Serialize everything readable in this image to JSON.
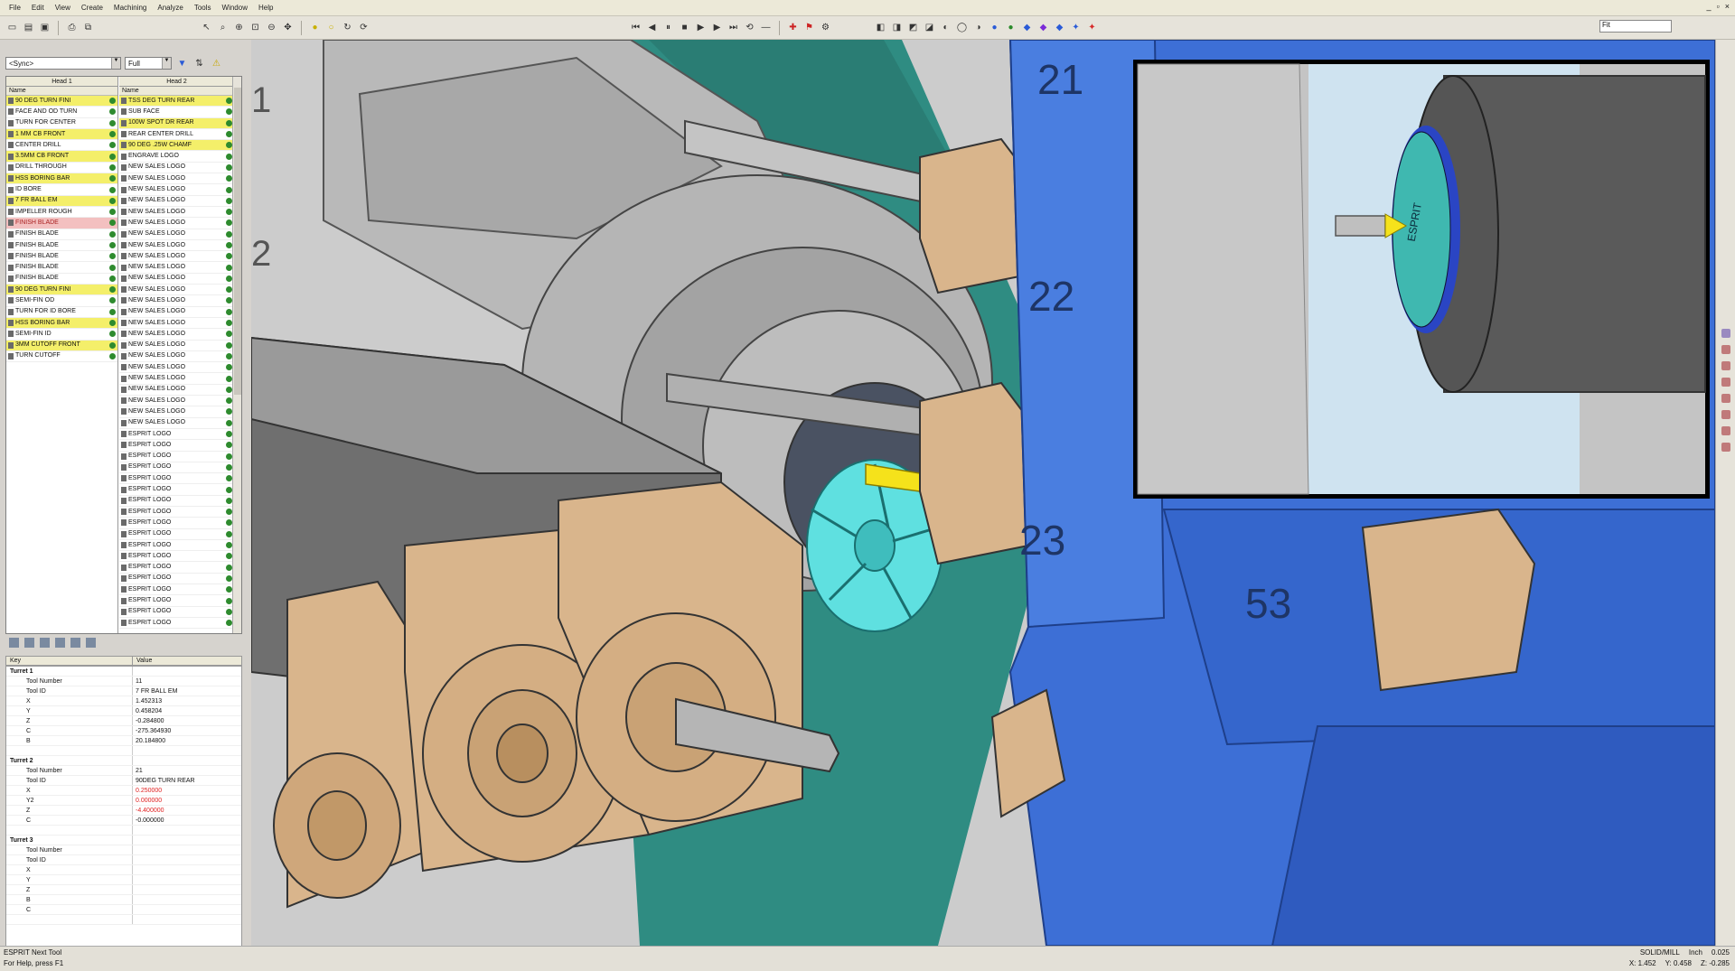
{
  "menu": [
    "File",
    "Edit",
    "View",
    "Create",
    "Machining",
    "Analyze",
    "Tools",
    "Window",
    "Help"
  ],
  "toolbar": {
    "zoom_value": "Fit"
  },
  "filter": {
    "group_value": "<Sync>",
    "size_value": "Full"
  },
  "ops": {
    "head1_label": "Head 1",
    "head2_label": "Head 2",
    "name_header": "Name",
    "head1_rows": [
      {
        "label": "90 DEG TURN FINI",
        "state": "hl"
      },
      {
        "label": "FACE AND OD TURN",
        "state": ""
      },
      {
        "label": "TURN FOR CENTER",
        "state": ""
      },
      {
        "label": "1 MM CB FRONT",
        "state": "hl"
      },
      {
        "label": "CENTER DRILL",
        "state": ""
      },
      {
        "label": "3.5MM CB FRONT",
        "state": "hl"
      },
      {
        "label": "DRILL THROUGH",
        "state": ""
      },
      {
        "label": "HSS BORING BAR",
        "state": "hl"
      },
      {
        "label": "ID BORE",
        "state": ""
      },
      {
        "label": "7 FR BALL EM",
        "state": "hl"
      },
      {
        "label": "IMPELLER ROUGH",
        "state": ""
      },
      {
        "label": "FINISH BLADE",
        "state": "sel"
      },
      {
        "label": "FINISH BLADE",
        "state": ""
      },
      {
        "label": "FINISH BLADE",
        "state": ""
      },
      {
        "label": "FINISH BLADE",
        "state": ""
      },
      {
        "label": "FINISH BLADE",
        "state": ""
      },
      {
        "label": "FINISH BLADE",
        "state": ""
      },
      {
        "label": "90 DEG TURN FINI",
        "state": "hl"
      },
      {
        "label": "SEMI-FIN OD",
        "state": ""
      },
      {
        "label": "TURN FOR ID BORE",
        "state": ""
      },
      {
        "label": "HSS BORING BAR",
        "state": "hl"
      },
      {
        "label": "SEMI-FIN ID",
        "state": ""
      },
      {
        "label": "3MM CUTOFF FRONT",
        "state": "hl"
      },
      {
        "label": "TURN CUTOFF",
        "state": ""
      }
    ],
    "head2_rows": [
      {
        "label": "TSS DEG TURN REAR",
        "state": "hl"
      },
      {
        "label": "SUB FACE",
        "state": ""
      },
      {
        "label": "100W SPOT DR REAR",
        "state": "hl"
      },
      {
        "label": "REAR CENTER DRILL",
        "state": ""
      },
      {
        "label": "90 DEG .25W CHAMF",
        "state": "hl"
      },
      {
        "label": "ENGRAVE LOGO",
        "state": ""
      },
      {
        "label": "NEW SALES LOGO",
        "state": ""
      },
      {
        "label": "NEW SALES LOGO",
        "state": ""
      },
      {
        "label": "NEW SALES LOGO",
        "state": ""
      },
      {
        "label": "NEW SALES LOGO",
        "state": ""
      },
      {
        "label": "NEW SALES LOGO",
        "state": ""
      },
      {
        "label": "NEW SALES LOGO",
        "state": ""
      },
      {
        "label": "NEW SALES LOGO",
        "state": ""
      },
      {
        "label": "NEW SALES LOGO",
        "state": ""
      },
      {
        "label": "NEW SALES LOGO",
        "state": ""
      },
      {
        "label": "NEW SALES LOGO",
        "state": ""
      },
      {
        "label": "NEW SALES LOGO",
        "state": ""
      },
      {
        "label": "NEW SALES LOGO",
        "state": ""
      },
      {
        "label": "NEW SALES LOGO",
        "state": ""
      },
      {
        "label": "NEW SALES LOGO",
        "state": ""
      },
      {
        "label": "NEW SALES LOGO",
        "state": ""
      },
      {
        "label": "NEW SALES LOGO",
        "state": ""
      },
      {
        "label": "NEW SALES LOGO",
        "state": ""
      },
      {
        "label": "NEW SALES LOGO",
        "state": ""
      },
      {
        "label": "NEW SALES LOGO",
        "state": ""
      },
      {
        "label": "NEW SALES LOGO",
        "state": ""
      },
      {
        "label": "NEW SALES LOGO",
        "state": ""
      },
      {
        "label": "NEW SALES LOGO",
        "state": ""
      },
      {
        "label": "NEW SALES LOGO",
        "state": ""
      },
      {
        "label": "NEW SALES LOGO",
        "state": ""
      },
      {
        "label": "ESPRIT LOGO",
        "state": ""
      },
      {
        "label": "ESPRIT LOGO",
        "state": ""
      },
      {
        "label": "ESPRIT LOGO",
        "state": ""
      },
      {
        "label": "ESPRIT LOGO",
        "state": ""
      },
      {
        "label": "ESPRIT LOGO",
        "state": ""
      },
      {
        "label": "ESPRIT LOGO",
        "state": ""
      },
      {
        "label": "ESPRIT LOGO",
        "state": ""
      },
      {
        "label": "ESPRIT LOGO",
        "state": ""
      },
      {
        "label": "ESPRIT LOGO",
        "state": ""
      },
      {
        "label": "ESPRIT LOGO",
        "state": ""
      },
      {
        "label": "ESPRIT LOGO",
        "state": ""
      },
      {
        "label": "ESPRIT LOGO",
        "state": ""
      },
      {
        "label": "ESPRIT LOGO",
        "state": ""
      },
      {
        "label": "ESPRIT LOGO",
        "state": ""
      },
      {
        "label": "ESPRIT LOGO",
        "state": ""
      },
      {
        "label": "ESPRIT LOGO",
        "state": ""
      },
      {
        "label": "ESPRIT LOGO",
        "state": ""
      },
      {
        "label": "ESPRIT LOGO",
        "state": ""
      }
    ]
  },
  "props": {
    "key_header": "Key",
    "value_header": "Value",
    "rows": [
      {
        "k": "Turret 1",
        "v": "",
        "type": "grp",
        "red": false
      },
      {
        "k": "Tool Number",
        "v": "11",
        "type": "ch",
        "red": false
      },
      {
        "k": "Tool ID",
        "v": "7 FR BALL EM",
        "type": "ch",
        "red": false
      },
      {
        "k": "X",
        "v": "1.452313",
        "type": "ch",
        "red": false
      },
      {
        "k": "Y",
        "v": "0.458204",
        "type": "ch",
        "red": false
      },
      {
        "k": "Z",
        "v": "-0.284800",
        "type": "ch",
        "red": false
      },
      {
        "k": "C",
        "v": "-275.364930",
        "type": "ch",
        "red": false
      },
      {
        "k": "B",
        "v": "20.184800",
        "type": "ch",
        "red": false
      },
      {
        "k": "",
        "v": "",
        "type": "ch",
        "red": false
      },
      {
        "k": "Turret 2",
        "v": "",
        "type": "grp",
        "red": false
      },
      {
        "k": "Tool Number",
        "v": "21",
        "type": "ch",
        "red": false
      },
      {
        "k": "Tool ID",
        "v": "90DEG TURN REAR",
        "type": "ch",
        "red": false
      },
      {
        "k": "X",
        "v": "0.250000",
        "type": "ch",
        "red": true
      },
      {
        "k": "Y2",
        "v": "0.000000",
        "type": "ch",
        "red": true
      },
      {
        "k": "Z",
        "v": "-4.400000",
        "type": "ch",
        "red": true
      },
      {
        "k": "C",
        "v": "-0.000000",
        "type": "ch",
        "red": false
      },
      {
        "k": "",
        "v": "",
        "type": "ch",
        "red": false
      },
      {
        "k": "Turret 3",
        "v": "",
        "type": "grp",
        "red": false
      },
      {
        "k": "Tool Number",
        "v": "",
        "type": "ch",
        "red": false
      },
      {
        "k": "Tool ID",
        "v": "",
        "type": "ch",
        "red": false
      },
      {
        "k": "X",
        "v": "",
        "type": "ch",
        "red": false
      },
      {
        "k": "Y",
        "v": "",
        "type": "ch",
        "red": false
      },
      {
        "k": "Z",
        "v": "",
        "type": "ch",
        "red": false
      },
      {
        "k": "B",
        "v": "",
        "type": "ch",
        "red": false
      },
      {
        "k": "C",
        "v": "",
        "type": "ch",
        "red": false
      },
      {
        "k": "",
        "v": "",
        "type": "ch",
        "red": false
      }
    ]
  },
  "viewport": {
    "turret_numbers": [
      "21",
      "22",
      "23",
      "53",
      "1",
      "2"
    ],
    "logo_text": "ESPRIT"
  },
  "status": {
    "line1": "ESPRIT Next Tool",
    "line2": "For Help, press F1",
    "right1": [
      "SOLID/MILL",
      "Inch",
      "0.025"
    ],
    "right2": [
      "X: 1.452",
      "Y: 0.458",
      "Z: -0.285"
    ]
  },
  "colors": {
    "turret_blue": "#3d6fd6",
    "holder_tan": "#d9b58c",
    "spindle_teal": "#2f8c82",
    "part_cyan": "#5fe0e0",
    "tool_yellow": "#f5e21b",
    "highlight_yellow": "#f4ef6a"
  }
}
